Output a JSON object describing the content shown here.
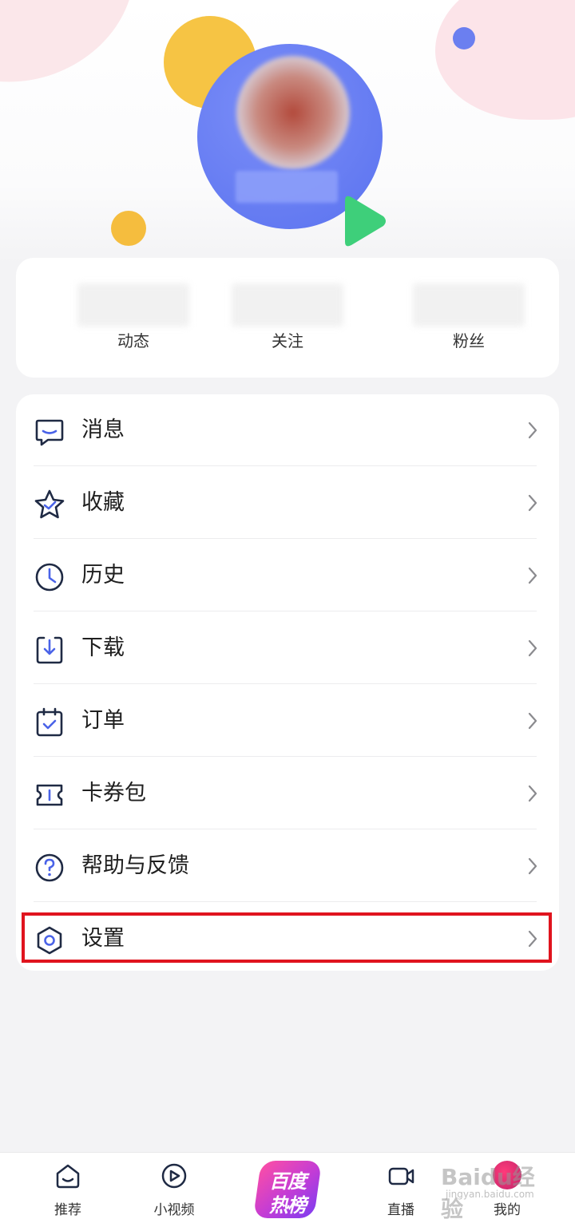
{
  "stats": [
    {
      "count": "",
      "label": "动态"
    },
    {
      "count": "",
      "label": "关注"
    },
    {
      "count": "",
      "label": "粉丝"
    }
  ],
  "menu": [
    {
      "label": "消息",
      "icon": "message-icon"
    },
    {
      "label": "收藏",
      "icon": "star-icon"
    },
    {
      "label": "历史",
      "icon": "clock-icon"
    },
    {
      "label": "下载",
      "icon": "download-icon"
    },
    {
      "label": "订单",
      "icon": "order-calendar-icon"
    },
    {
      "label": "卡券包",
      "icon": "ticket-icon"
    },
    {
      "label": "帮助与反馈",
      "icon": "help-icon"
    },
    {
      "label": "设置",
      "icon": "settings-icon"
    }
  ],
  "highlighted_item": "设置",
  "bottom_nav": {
    "items": [
      {
        "label": "推荐",
        "icon": "home-icon"
      },
      {
        "label": "小视频",
        "icon": "play-circle-icon"
      },
      {
        "label": "直播",
        "icon": "video-camera-icon"
      },
      {
        "label": "我的",
        "icon": "avatar-icon"
      }
    ],
    "center_badge": {
      "line1": "百度",
      "line2": "热榜"
    }
  },
  "watermark": {
    "main": "Baidu经验",
    "sub": "jingyan.baidu.com"
  },
  "colors": {
    "accent_blue": "#5a72ef",
    "icon_stroke": "#1f2a44",
    "icon_accent": "#4a63e8",
    "highlight_red": "#e0141e",
    "yellow": "#f6c444",
    "green": "#3ecf7a"
  }
}
